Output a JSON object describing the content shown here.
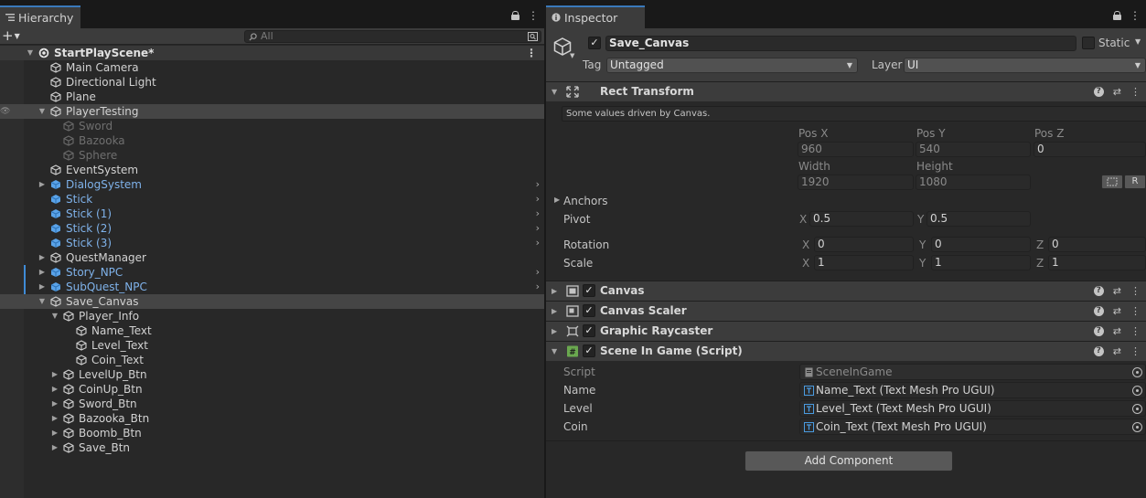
{
  "hierarchy": {
    "tab_label": "Hierarchy",
    "search_placeholder": "All",
    "scene_name": "StartPlayScene*",
    "items": [
      {
        "label": "Main Camera",
        "depth": 1,
        "type": "go",
        "arrow": ""
      },
      {
        "label": "Directional Light",
        "depth": 1,
        "type": "go",
        "arrow": ""
      },
      {
        "label": "Plane",
        "depth": 1,
        "type": "go",
        "arrow": ""
      },
      {
        "label": "PlayerTesting",
        "depth": 1,
        "type": "go",
        "arrow": "down",
        "selected_hover": true
      },
      {
        "label": "Sword",
        "depth": 2,
        "type": "disabled",
        "arrow": ""
      },
      {
        "label": "Bazooka",
        "depth": 2,
        "type": "disabled",
        "arrow": ""
      },
      {
        "label": "Sphere",
        "depth": 2,
        "type": "disabled",
        "arrow": ""
      },
      {
        "label": "EventSystem",
        "depth": 1,
        "type": "go",
        "arrow": ""
      },
      {
        "label": "DialogSystem",
        "depth": 1,
        "type": "prefab",
        "arrow": "right",
        "chevron": true
      },
      {
        "label": "Stick",
        "depth": 1,
        "type": "prefab",
        "arrow": "",
        "chevron": true
      },
      {
        "label": "Stick (1)",
        "depth": 1,
        "type": "prefab",
        "arrow": "",
        "chevron": true
      },
      {
        "label": "Stick (2)",
        "depth": 1,
        "type": "prefab",
        "arrow": "",
        "chevron": true
      },
      {
        "label": "Stick (3)",
        "depth": 1,
        "type": "prefab",
        "arrow": "",
        "chevron": true
      },
      {
        "label": "QuestManager",
        "depth": 1,
        "type": "go",
        "arrow": "right"
      },
      {
        "label": "Story_NPC",
        "depth": 1,
        "type": "prefab",
        "arrow": "right",
        "chevron": true,
        "bluebar": true
      },
      {
        "label": "SubQuest_NPC",
        "depth": 1,
        "type": "prefab",
        "arrow": "right",
        "chevron": true,
        "bluebar": true
      },
      {
        "label": "Save_Canvas",
        "depth": 1,
        "type": "go",
        "arrow": "down",
        "selected": true
      },
      {
        "label": "Player_Info",
        "depth": 2,
        "type": "go",
        "arrow": "down"
      },
      {
        "label": "Name_Text",
        "depth": 3,
        "type": "go",
        "arrow": ""
      },
      {
        "label": "Level_Text",
        "depth": 3,
        "type": "go",
        "arrow": ""
      },
      {
        "label": "Coin_Text",
        "depth": 3,
        "type": "go",
        "arrow": ""
      },
      {
        "label": "LevelUp_Btn",
        "depth": 2,
        "type": "go",
        "arrow": "right"
      },
      {
        "label": "CoinUp_Btn",
        "depth": 2,
        "type": "go",
        "arrow": "right"
      },
      {
        "label": "Sword_Btn",
        "depth": 2,
        "type": "go",
        "arrow": "right"
      },
      {
        "label": "Bazooka_Btn",
        "depth": 2,
        "type": "go",
        "arrow": "right"
      },
      {
        "label": "Boomb_Btn",
        "depth": 2,
        "type": "go",
        "arrow": "right"
      },
      {
        "label": "Save_Btn",
        "depth": 2,
        "type": "go",
        "arrow": "right"
      }
    ]
  },
  "inspector": {
    "tab_label": "Inspector",
    "object_name": "Save_Canvas",
    "static_label": "Static",
    "tag_label": "Tag",
    "tag_value": "Untagged",
    "layer_label": "Layer",
    "layer_value": "UI",
    "rect_transform": {
      "title": "Rect Transform",
      "note": "Some values driven by Canvas.",
      "pos_x_label": "Pos X",
      "pos_x": "960",
      "pos_y_label": "Pos Y",
      "pos_y": "540",
      "pos_z_label": "Pos Z",
      "pos_z": "0",
      "width_label": "Width",
      "width": "1920",
      "height_label": "Height",
      "height": "1080",
      "r_button": "R",
      "anchors_label": "Anchors",
      "pivot_label": "Pivot",
      "pivot_x": "0.5",
      "pivot_y": "0.5",
      "rotation_label": "Rotation",
      "rot_x": "0",
      "rot_y": "0",
      "rot_z": "0",
      "scale_label": "Scale",
      "scale_x": "1",
      "scale_y": "1",
      "scale_z": "1",
      "x_label": "X",
      "y_label": "Y",
      "z_label": "Z"
    },
    "components": [
      {
        "name": "Canvas"
      },
      {
        "name": "Canvas Scaler"
      },
      {
        "name": "Graphic Raycaster"
      }
    ],
    "script_component": {
      "title": "Scene In Game (Script)",
      "script_label": "Script",
      "script_value": "SceneInGame",
      "name_label": "Name",
      "name_value": "Name_Text (Text Mesh Pro UGUI)",
      "level_label": "Level",
      "level_value": "Level_Text (Text Mesh Pro UGUI)",
      "coin_label": "Coin",
      "coin_value": "Coin_Text (Text Mesh Pro UGUI)"
    },
    "add_component_label": "Add Component"
  }
}
